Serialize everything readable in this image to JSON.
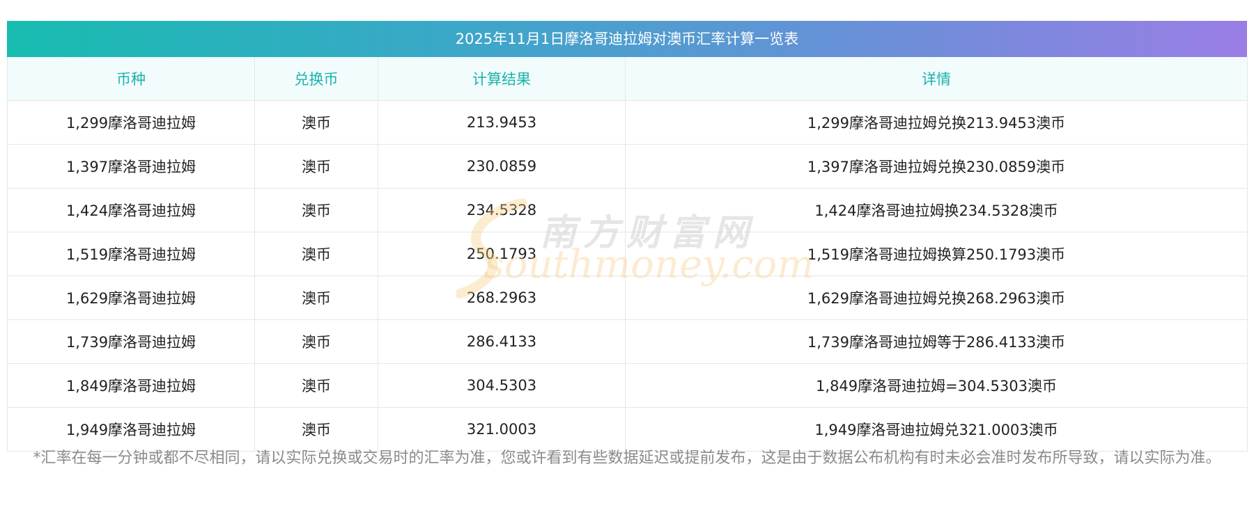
{
  "table": {
    "title": "2025年11月1日摩洛哥迪拉姆对澳币汇率计算一览表",
    "headers": [
      "币种",
      "兑换币",
      "计算结果",
      "详情"
    ],
    "rows": [
      [
        "1,299摩洛哥迪拉姆",
        "澳币",
        "213.9453",
        "1,299摩洛哥迪拉姆兑换213.9453澳币"
      ],
      [
        "1,397摩洛哥迪拉姆",
        "澳币",
        "230.0859",
        "1,397摩洛哥迪拉姆兑换230.0859澳币"
      ],
      [
        "1,424摩洛哥迪拉姆",
        "澳币",
        "234.5328",
        "1,424摩洛哥迪拉姆换234.5328澳币"
      ],
      [
        "1,519摩洛哥迪拉姆",
        "澳币",
        "250.1793",
        "1,519摩洛哥迪拉姆换算250.1793澳币"
      ],
      [
        "1,629摩洛哥迪拉姆",
        "澳币",
        "268.2963",
        "1,629摩洛哥迪拉姆兑换268.2963澳币"
      ],
      [
        "1,739摩洛哥迪拉姆",
        "澳币",
        "286.4133",
        "1,739摩洛哥迪拉姆等于286.4133澳币"
      ],
      [
        "1,849摩洛哥迪拉姆",
        "澳币",
        "304.5303",
        "1,849摩洛哥迪拉姆=304.5303澳币"
      ],
      [
        "1,949摩洛哥迪拉姆",
        "澳币",
        "321.0003",
        "1,949摩洛哥迪拉姆兑321.0003澳币"
      ]
    ]
  },
  "footnote": "*汇率在每一分钟或都不尽相同，请以实际兑换或交易时的汇率为准，您或许看到有些数据延迟或提前发布，这是由于数据公布机构有时未必会准时发布所导致，请以实际为准。",
  "watermark": {
    "cn": "南方财富网",
    "en": "southmoney.com"
  },
  "colors": {
    "title_gradient_start": "#18bcb0",
    "title_gradient_end": "#9a7ee6",
    "header_text": "#19b3ac",
    "header_bg": "#f2fcfd",
    "footnote_text": "#8a8a8a"
  }
}
